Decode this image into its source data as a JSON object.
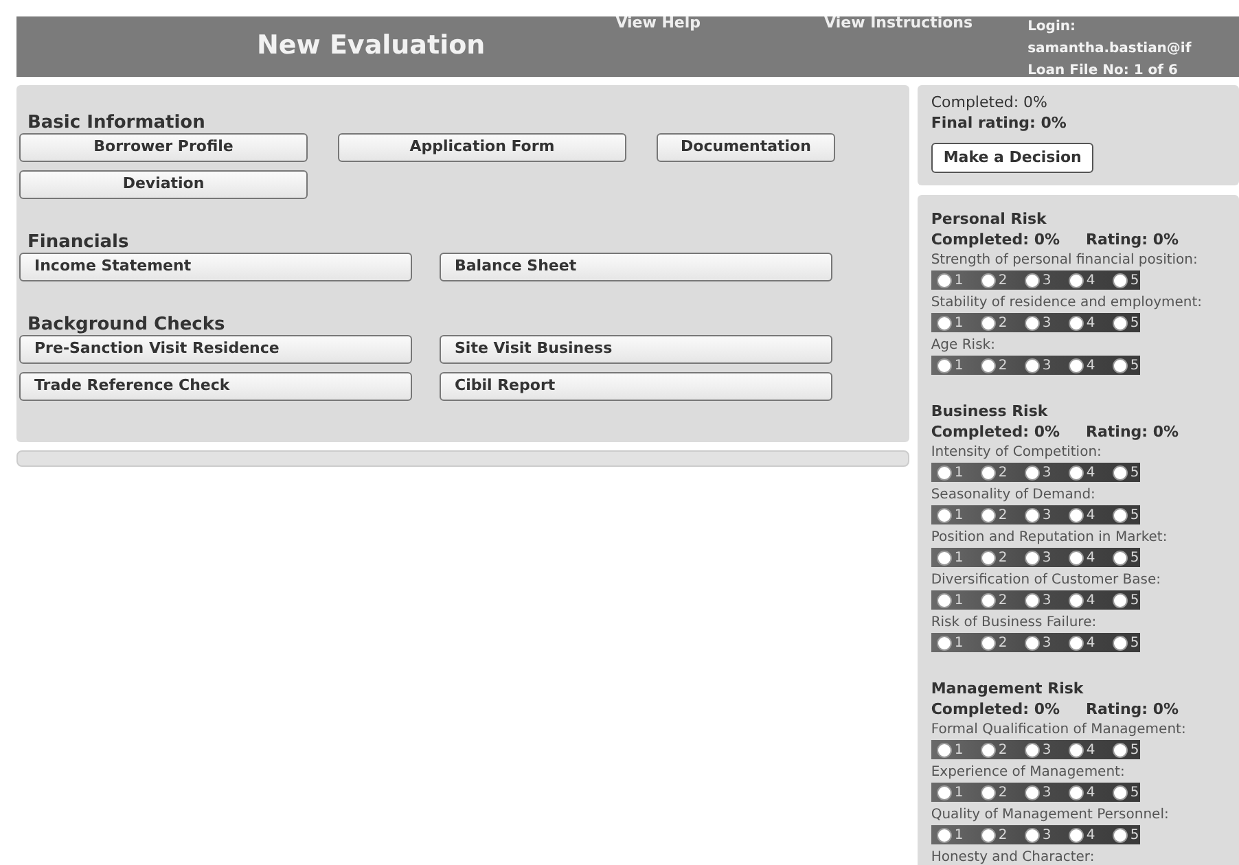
{
  "header": {
    "title": "New Evaluation",
    "links": [
      "View Help",
      "View Instructions"
    ],
    "login_label": "Login:",
    "login_user": "samantha.bastian@if",
    "loan_file": "Loan File No: 1 of 6"
  },
  "sections": [
    {
      "title": "Basic Information",
      "buttons": [
        "Borrower Profile",
        "Application Form",
        "Documentation",
        "Deviation"
      ]
    },
    {
      "title": "Financials",
      "buttons": [
        "Income Statement",
        "Balance Sheet"
      ]
    },
    {
      "title": "Background Checks",
      "buttons": [
        "Pre-Sanction Visit Residence",
        "Site Visit Business",
        "Trade Reference Check",
        "Cibil Report"
      ]
    }
  ],
  "summary": {
    "completed": "Completed: 0%",
    "final_rating": "Final rating: 0%",
    "decision_button": "Make a Decision"
  },
  "risk_groups": [
    {
      "title": "Personal Risk",
      "completed": "Completed: 0%",
      "rating": "Rating: 0%",
      "questions": [
        {
          "label": "Strength of personal financial position:",
          "options": [
            {
              "label": "1",
              "selected": false
            },
            {
              "label": "2",
              "selected": false
            },
            {
              "label": "3",
              "selected": false
            },
            {
              "label": "4",
              "selected": false
            },
            {
              "label": "5",
              "selected": false
            }
          ]
        },
        {
          "label": "Stability of residence and employment:",
          "options": [
            {
              "label": "1",
              "selected": false
            },
            {
              "label": "2",
              "selected": false
            },
            {
              "label": "3",
              "selected": false
            },
            {
              "label": "4",
              "selected": false
            },
            {
              "label": "5",
              "selected": false
            }
          ]
        },
        {
          "label": "Age Risk:",
          "options": [
            {
              "label": "1",
              "selected": false
            },
            {
              "label": "2",
              "selected": false
            },
            {
              "label": "3",
              "selected": false
            },
            {
              "label": "4",
              "selected": false
            },
            {
              "label": "5",
              "selected": false
            }
          ]
        }
      ]
    },
    {
      "title": "Business Risk",
      "completed": "Completed: 0%",
      "rating": "Rating: 0%",
      "questions": [
        {
          "label": "Intensity of Competition:",
          "options": [
            {
              "label": "1",
              "selected": false
            },
            {
              "label": "2",
              "selected": false
            },
            {
              "label": "3",
              "selected": false
            },
            {
              "label": "4",
              "selected": false
            },
            {
              "label": "5",
              "selected": false
            }
          ]
        },
        {
          "label": "Seasonality of Demand:",
          "options": [
            {
              "label": "1",
              "selected": false
            },
            {
              "label": "2",
              "selected": false
            },
            {
              "label": "3",
              "selected": false
            },
            {
              "label": "4",
              "selected": false
            },
            {
              "label": "5",
              "selected": false
            }
          ]
        },
        {
          "label": "Position and Reputation in Market:",
          "options": [
            {
              "label": "1",
              "selected": false
            },
            {
              "label": "2",
              "selected": false
            },
            {
              "label": "3",
              "selected": false
            },
            {
              "label": "4",
              "selected": false
            },
            {
              "label": "5",
              "selected": false
            }
          ]
        },
        {
          "label": "Diversification of Customer Base:",
          "options": [
            {
              "label": "1",
              "selected": false
            },
            {
              "label": "2",
              "selected": false
            },
            {
              "label": "3",
              "selected": false
            },
            {
              "label": "4",
              "selected": false
            },
            {
              "label": "5",
              "selected": false
            }
          ]
        },
        {
          "label": "Risk of Business Failure:",
          "options": [
            {
              "label": "1",
              "selected": false
            },
            {
              "label": "2",
              "selected": false
            },
            {
              "label": "3",
              "selected": false
            },
            {
              "label": "4",
              "selected": false
            },
            {
              "label": "5",
              "selected": false
            }
          ]
        }
      ]
    },
    {
      "title": "Management Risk",
      "completed": "Completed: 0%",
      "rating": "Rating: 0%",
      "questions": [
        {
          "label": "Formal Qualification of Management:",
          "options": [
            {
              "label": "1",
              "selected": false
            },
            {
              "label": "2",
              "selected": false
            },
            {
              "label": "3",
              "selected": false
            },
            {
              "label": "4",
              "selected": false
            },
            {
              "label": "5",
              "selected": false
            }
          ]
        },
        {
          "label": "Experience of Management:",
          "options": [
            {
              "label": "1",
              "selected": false
            },
            {
              "label": "2",
              "selected": false
            },
            {
              "label": "3",
              "selected": false
            },
            {
              "label": "4",
              "selected": false
            },
            {
              "label": "5",
              "selected": false
            }
          ]
        },
        {
          "label": "Quality of Management Personnel:",
          "options": [
            {
              "label": "1",
              "selected": false
            },
            {
              "label": "2",
              "selected": false
            },
            {
              "label": "3",
              "selected": false
            },
            {
              "label": "4",
              "selected": false
            },
            {
              "label": "5",
              "selected": false
            }
          ]
        },
        {
          "label": "Honesty and Character:"
        }
      ]
    }
  ]
}
